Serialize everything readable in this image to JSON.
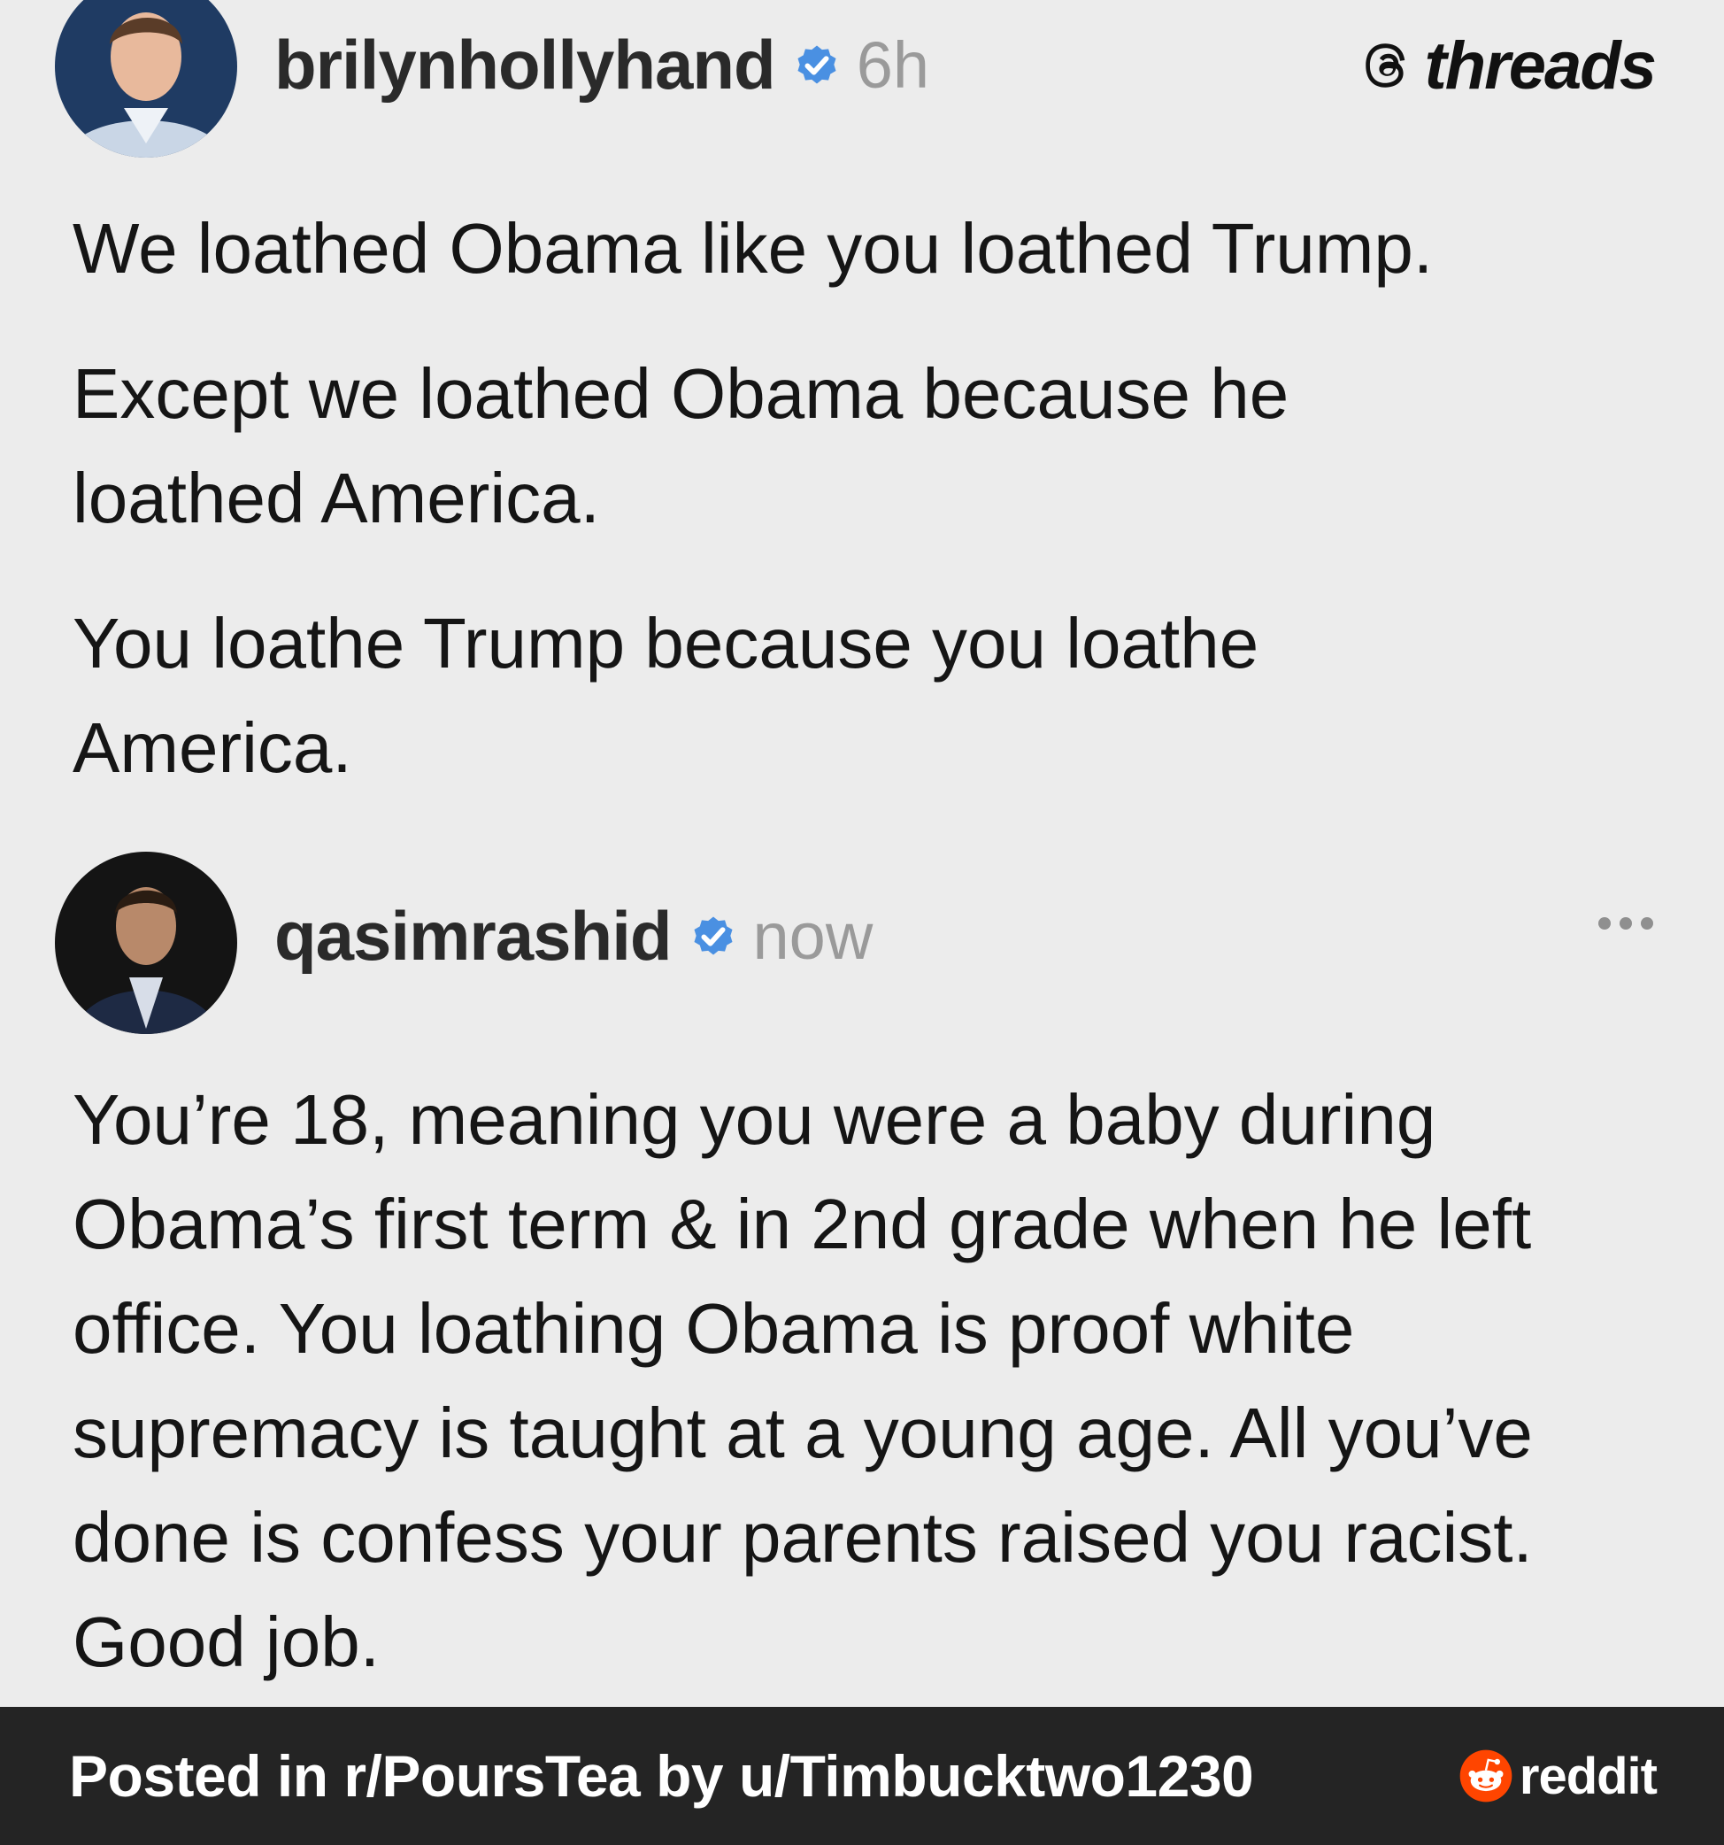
{
  "post1": {
    "username": "brilynhollyhand",
    "time": "6h",
    "paragraphs": [
      "We loathed Obama like you loathed Trump.",
      "Except we loathed Obama because he loathed America.",
      "You loathe Trump because you loathe America."
    ]
  },
  "brand": {
    "name": "threads"
  },
  "post2": {
    "username": "qasimrashid",
    "time": "now",
    "paragraphs": [
      "You’re 18, meaning you were a baby during Obama’s first term & in 2nd grade when he left office. You loathing Obama is proof white supremacy is taught at a young age. All you’ve done is confess your parents raised you racist. Good job."
    ]
  },
  "footer": {
    "text": "Posted in r/PoursTea by u/Timbucktwo1230",
    "brand": "reddit"
  },
  "icons": {
    "verified": "verified-badge-icon",
    "threads": "threads-logo-icon",
    "more": "more-options-icon",
    "reddit": "reddit-logo-icon"
  },
  "colors": {
    "background": "#ececec",
    "verified_blue": "#4a90e2",
    "footer_bg": "#242424",
    "reddit_orange": "#ff4500"
  }
}
